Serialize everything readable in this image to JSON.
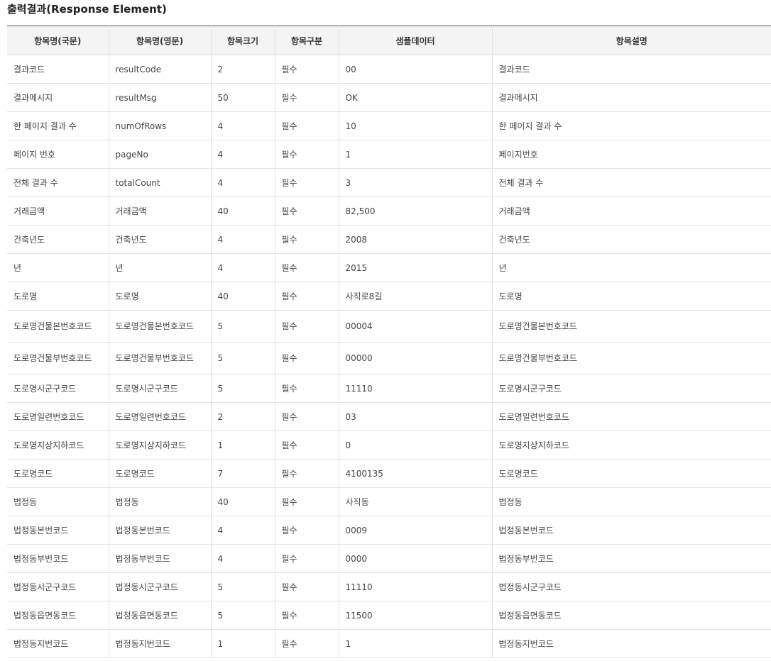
{
  "section_title": "출력결과(Response Element)",
  "table": {
    "headers": [
      "항목명(국문)",
      "항목명(영문)",
      "항목크기",
      "항목구분",
      "샘플데이터",
      "항목설명"
    ],
    "rows": [
      [
        "결과코드",
        "resultCode",
        "2",
        "필수",
        "00",
        "결과코드"
      ],
      [
        "결과메시지",
        "resultMsg",
        "50",
        "필수",
        "OK",
        "결과메시지"
      ],
      [
        "한 페이지 결과 수",
        "numOfRows",
        "4",
        "필수",
        "10",
        "한 페이지 결과 수"
      ],
      [
        "페이지 번호",
        "pageNo",
        "4",
        "필수",
        "1",
        "페이지번호"
      ],
      [
        "전체 결과 수",
        "totalCount",
        "4",
        "필수",
        "3",
        "전체 결과 수"
      ],
      [
        "거래금액",
        "거래금액",
        "40",
        "필수",
        "82,500",
        "거래금액"
      ],
      [
        "건축년도",
        "건축년도",
        "4",
        "필수",
        "2008",
        "건축년도"
      ],
      [
        "년",
        "년",
        "4",
        "필수",
        "2015",
        "년"
      ],
      [
        "도로명",
        "도로명",
        "40",
        "필수",
        "사직로8길",
        "도로명"
      ],
      [
        "도로명건물본번호코드",
        "도로명건물본번호코드",
        "5",
        "필수",
        "00004",
        "도로명건물본번호코드"
      ],
      [
        "도로명건물부번호코드",
        "도로명건물부번호코드",
        "5",
        "필수",
        "00000",
        "도로명건물부번호코드"
      ],
      [
        "도로명시군구코드",
        "도로명시군구코드",
        "5",
        "필수",
        "11110",
        "도로명시군구코드"
      ],
      [
        "도로명일련번호코드",
        "도로명일련번호코드",
        "2",
        "필수",
        "03",
        "도로명일련번호코드"
      ],
      [
        "도로명지상지하코드",
        "도로명지상지하코드",
        "1",
        "필수",
        "0",
        "도로명지상지하코드"
      ],
      [
        "도로명코드",
        "도로명코드",
        "7",
        "필수",
        "4100135",
        "도로명코드"
      ],
      [
        "법정동",
        "법정동",
        "40",
        "필수",
        "사직동",
        "법정동"
      ],
      [
        "법정동본번코드",
        "법정동본번코드",
        "4",
        "필수",
        "0009",
        "법정동본번코드"
      ],
      [
        "법정동부번코드",
        "법정동부번코드",
        "4",
        "필수",
        "0000",
        "법정동부번코드"
      ],
      [
        "법정동시군구코드",
        "법정동시군구코드",
        "5",
        "필수",
        "11110",
        "법정동시군구코드"
      ],
      [
        "법정동읍면동코드",
        "법정동읍면동코드",
        "5",
        "필수",
        "11500",
        "법정동읍면동코드"
      ],
      [
        "법정동지번코드",
        "법정동지번코드",
        "1",
        "필수",
        "1",
        "법정동지번코드"
      ]
    ]
  }
}
